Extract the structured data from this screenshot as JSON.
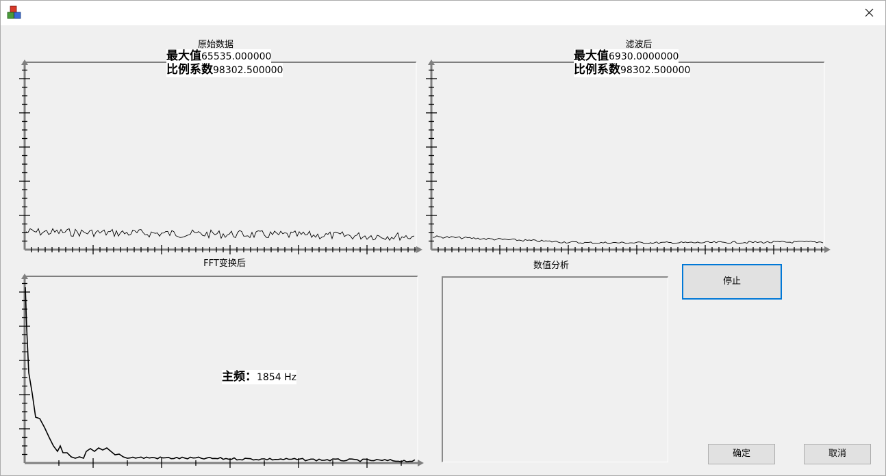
{
  "window": {
    "title": ""
  },
  "icons": {
    "app": "app-blocks-icon",
    "close": "close-icon"
  },
  "panels": {
    "raw": {
      "title": "原始数据",
      "max_label": "最大值",
      "max_value": "65535.000000",
      "scale_label": "比例系数",
      "scale_value": "98302.500000"
    },
    "filtered": {
      "title": "滤波后",
      "max_label": "最大值",
      "max_value": "6930.0000000",
      "scale_label": "比例系数",
      "scale_value": "98302.500000"
    },
    "fft": {
      "title": "FFT变换后",
      "freq_label": "主频：",
      "freq_value": "1854 Hz"
    },
    "analysis": {
      "title": "数值分析"
    }
  },
  "buttons": {
    "stop": "停止",
    "ok": "确定",
    "cancel": "取消"
  },
  "colors": {
    "axis": "#7f7f7f",
    "trace": "#000000",
    "focus": "#0078d7"
  }
}
